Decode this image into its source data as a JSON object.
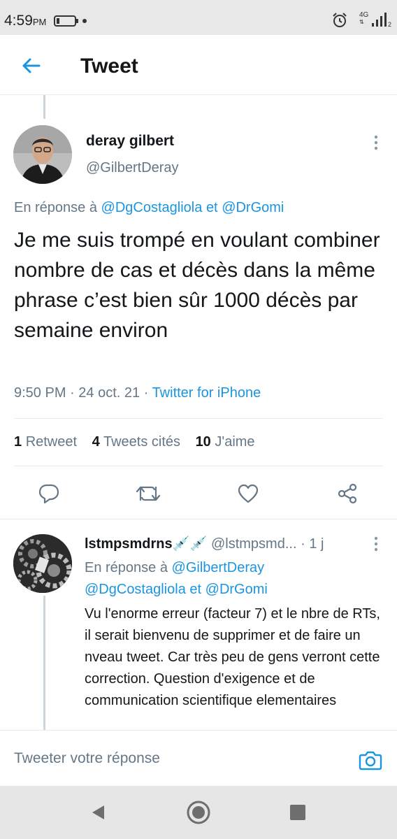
{
  "status_bar": {
    "time": "4:59",
    "ampm": "PM",
    "network": "4G",
    "sim": "2"
  },
  "header": {
    "title": "Tweet"
  },
  "main_tweet": {
    "author_name": "deray gilbert",
    "author_handle": "@GilbertDeray",
    "reply_prefix": "En réponse à",
    "reply_user1": "@DgCostagliola",
    "reply_and": "et",
    "reply_user2": "@DrGomi",
    "text": "Je me suis trompé en voulant combiner nombre de cas et décès dans la même phrase c’est bien sûr 1000 décès par semaine environ",
    "time": "9:50 PM",
    "date": "24 oct. 21",
    "dot": "·",
    "source": "Twitter for iPhone",
    "retweets_count": "1",
    "retweets_label": "Retweet",
    "quotes_count": "4",
    "quotes_label": "Tweets cités",
    "likes_count": "10",
    "likes_label": "J'aime"
  },
  "reply_tweet": {
    "author_name": "lstmpsmdrns",
    "emoji": "💉💉",
    "author_handle": "@lstmpsmd...",
    "age": "1 j",
    "dot": "·",
    "reply_prefix": "En réponse à",
    "reply_user1": "@GilbertDeray",
    "reply_user2": "@DgCostagliola",
    "reply_and": "et",
    "reply_user3": "@DrGomi",
    "text": "Vu l'enorme erreur (facteur 7) et le nbre de RTs, il serait bienvenu de supprimer et de faire un nveau tweet. Car très peu de gens verront cette correction. Question d'exigence et de communication scientifique elementaires"
  },
  "compose": {
    "placeholder": "Tweeter votre réponse"
  },
  "colors": {
    "accent": "#1b95e0",
    "secondary_text": "#657786",
    "primary_text": "#14171a",
    "divider": "#e6ecf0"
  },
  "icons": [
    "back-arrow-icon",
    "more-vertical-icon",
    "reply-icon",
    "retweet-icon",
    "like-icon",
    "share-icon",
    "camera-icon",
    "alarm-icon",
    "signal-icon",
    "battery-icon",
    "nav-back-icon",
    "nav-home-icon",
    "nav-recents-icon"
  ]
}
